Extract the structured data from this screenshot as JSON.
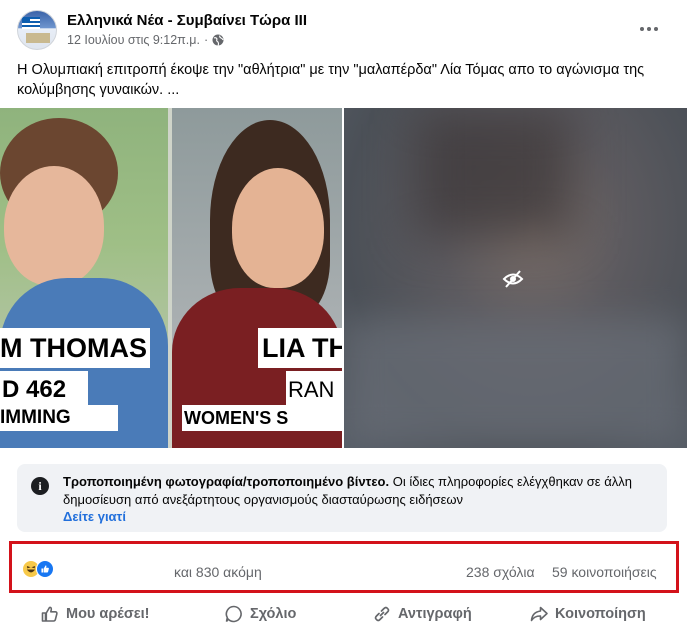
{
  "post": {
    "page_name": "Ελληνικά Νέα - Συμβαίνει Τώρα ΙΙΙ",
    "timestamp": "12 Ιουλίου στις 9:12π.μ.",
    "separator": "·",
    "caption": "Η Ολυμπιακή επιτροπή έκοψε την \"αθλήτρια\" με την \"μαλαπέρδα\" Λία Τόμας απο το αγώνισμα της κολύμβησης γυναικών. ..."
  },
  "image": {
    "left_name": "M THOMAS",
    "left_number": "D 462",
    "left_sport": "IMMING",
    "right_name": "LIA TH",
    "right_rank": "RAN",
    "right_sport": "WOMEN'S S"
  },
  "fact_check": {
    "title": "Τροποποιημένη φωτογραφία/τροποποιημένο βίντεο.",
    "body": " Οι ίδιες πληροφορίες ελέγχθηκαν σε άλλη δημοσίευση από ανεξάρτητους οργανισμούς διασταύρωσης ειδήσεων",
    "link": "Δείτε γιατί"
  },
  "stats": {
    "reactions": [
      "haha",
      "like"
    ],
    "others": "και 830 ακόμη",
    "comments": "238 σχόλια",
    "shares": "59 κοινοποιήσεις"
  },
  "actions": {
    "like": "Μου αρέσει!",
    "comment": "Σχόλιο",
    "copy": "Αντιγραφή",
    "share": "Κοινοποίηση"
  },
  "colors": {
    "highlight": "#d3121a",
    "link": "#216fdb",
    "secondary_text": "#65676b"
  }
}
